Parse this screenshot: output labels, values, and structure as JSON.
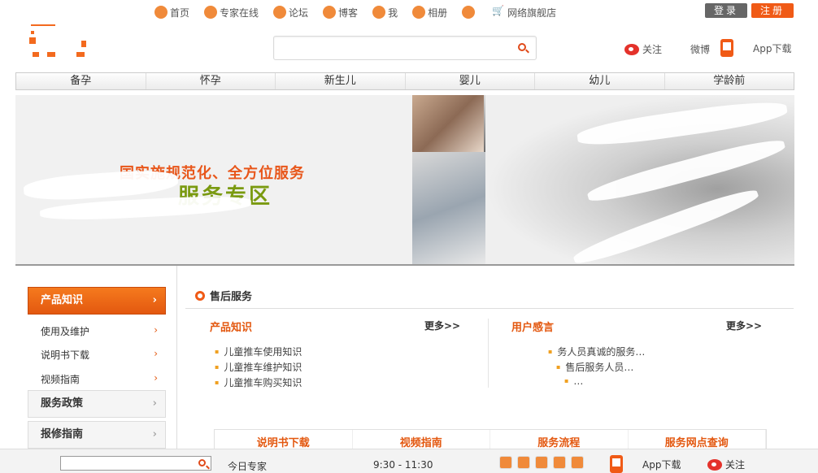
{
  "topnav": {
    "items": [
      {
        "label": "首页",
        "icon": "home-icon"
      },
      {
        "label": "专家在线",
        "icon": "expert-icon"
      },
      {
        "label": "论坛",
        "icon": "forum-icon"
      },
      {
        "label": "博客",
        "icon": "blog-icon"
      },
      {
        "label": "我",
        "icon": "star-icon"
      },
      {
        "label": "相册",
        "icon": "album-icon"
      },
      {
        "label": "",
        "icon": "person-icon"
      },
      {
        "label": "网络旗舰店",
        "icon": "cart-icon"
      }
    ],
    "login_label": "登录",
    "register_label": "注册"
  },
  "search": {
    "placeholder": ""
  },
  "header": {
    "follow_label": "关注",
    "weibo_label": "微博",
    "app_label": "App下载"
  },
  "categories": [
    "备孕",
    "怀孕",
    "新生儿",
    "婴儿",
    "幼儿",
    "学龄前"
  ],
  "banner": {
    "line1": "国实施规范化、全方位服务",
    "line2": "服务专区"
  },
  "sidebar": {
    "product_label": "产品知识",
    "sub_items": [
      "使用及维护",
      "说明书下载",
      "视频指南"
    ],
    "policy_label": "服务政策",
    "repair_label": "报修指南"
  },
  "main": {
    "title": "售后服务",
    "left": {
      "title": "产品知识",
      "more": "更多>>",
      "items": [
        "儿童推车使用知识",
        "儿童推车维护知识",
        "儿童推车购买知识"
      ]
    },
    "right": {
      "title": "用户感言",
      "more": "更多>>",
      "items": [
        "务人员真诚的服务…",
        "售后服务人员…",
        "…"
      ]
    },
    "tabs": [
      "说明书下载",
      "视频指南",
      "服务流程",
      "服务网点查询"
    ]
  },
  "footer": {
    "expert_label": "今日专家",
    "time": "9:30 - 11:30",
    "app_label": "App下载",
    "follow_label": "关注"
  },
  "colors": {
    "accent": "#f05a16",
    "green": "#7a9a10",
    "grey": "#666666"
  }
}
